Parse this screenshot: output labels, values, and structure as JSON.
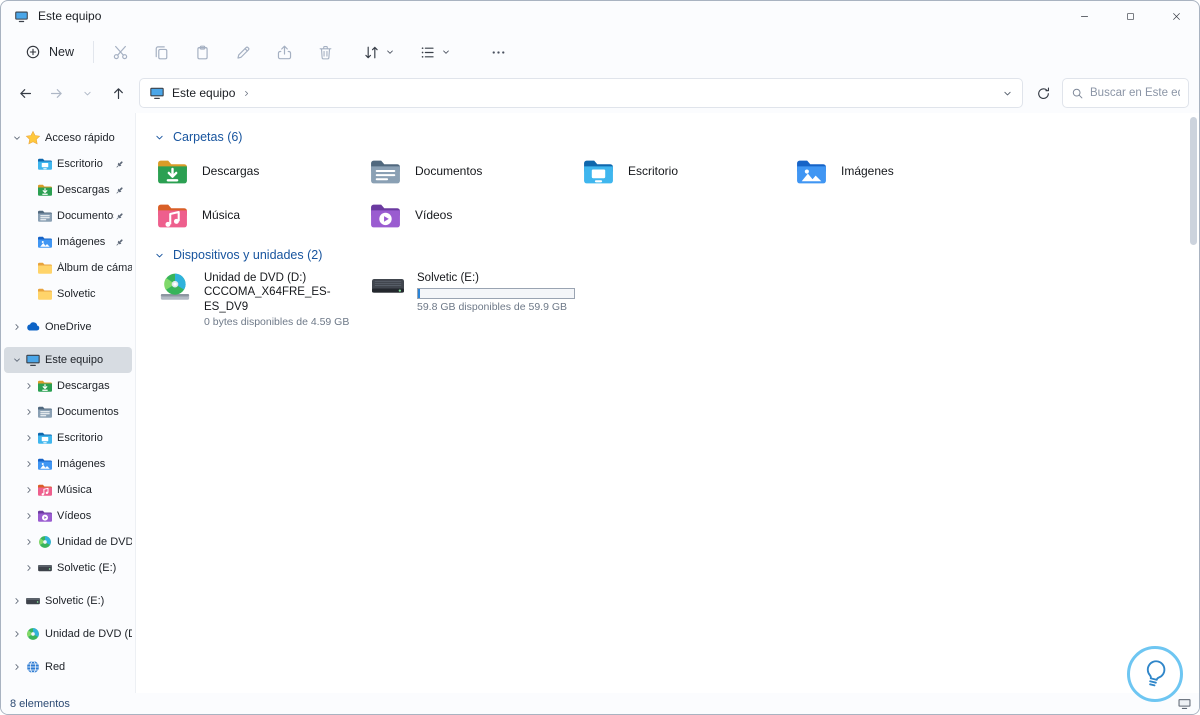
{
  "window": {
    "title": "Este equipo",
    "title_icon": "computer",
    "controls": [
      {
        "name": "minimize",
        "icon": "minimize"
      },
      {
        "name": "maximize",
        "icon": "maximize"
      },
      {
        "name": "close",
        "icon": "close"
      }
    ]
  },
  "toolbar": {
    "new_button": {
      "label": "New",
      "icon": "circle-plus"
    },
    "actions": [
      {
        "name": "cut",
        "icon": "cut",
        "enabled": false
      },
      {
        "name": "copy",
        "icon": "copy",
        "enabled": false
      },
      {
        "name": "paste",
        "icon": "paste",
        "enabled": false
      },
      {
        "name": "rename",
        "icon": "rename",
        "enabled": false
      },
      {
        "name": "share",
        "icon": "share",
        "enabled": false
      },
      {
        "name": "delete",
        "icon": "delete",
        "enabled": false
      }
    ],
    "sort_button": {
      "name": "sort",
      "icon": "sort"
    },
    "view_button": {
      "name": "view",
      "icon": "view"
    },
    "more_button": {
      "name": "more-options",
      "icon": "more"
    }
  },
  "navigation": [
    {
      "name": "back",
      "icon": "arrow-left",
      "enabled": true
    },
    {
      "name": "forward",
      "icon": "arrow-right",
      "enabled": false
    },
    {
      "name": "recent-locations",
      "icon": "chevron-down",
      "enabled": false
    },
    {
      "name": "up",
      "icon": "arrow-up",
      "enabled": true
    }
  ],
  "addressbar": {
    "root_icon": "computer",
    "path": "Este equipo",
    "separator_icon": "chevron-right",
    "dropdown_icon": "chevron-down",
    "refresh_icon": "refresh"
  },
  "search": {
    "icon": "search",
    "placeholder": "Buscar en Este eq..."
  },
  "sidebar": {
    "items": [
      {
        "label": "Acceso rápido",
        "icon": "quick-access",
        "level": 0,
        "chevron": "down"
      },
      {
        "label": "Escritorio",
        "icon": "desktop-folder",
        "level": 1,
        "pinned": true
      },
      {
        "label": "Descargas",
        "icon": "downloads-folder",
        "level": 1,
        "pinned": true
      },
      {
        "label": "Documentos",
        "icon": "documents-folder",
        "level": 1,
        "pinned": true
      },
      {
        "label": "Imágenes",
        "icon": "pictures-folder",
        "level": 1,
        "pinned": true
      },
      {
        "label": "Álbum de cámara",
        "icon": "folder",
        "level": 1
      },
      {
        "label": "Solvetic",
        "icon": "folder",
        "level": 1
      },
      {
        "spacer": true
      },
      {
        "label": "OneDrive",
        "icon": "onedrive",
        "level": 0,
        "chevron": "right"
      },
      {
        "spacer": true
      },
      {
        "label": "Este equipo",
        "icon": "computer",
        "level": 0,
        "chevron": "down",
        "selected": true
      },
      {
        "label": "Descargas",
        "icon": "downloads-folder",
        "level": 1,
        "chevron": "right"
      },
      {
        "label": "Documentos",
        "icon": "documents-folder",
        "level": 1,
        "chevron": "right"
      },
      {
        "label": "Escritorio",
        "icon": "desktop-folder",
        "level": 1,
        "chevron": "right"
      },
      {
        "label": "Imágenes",
        "icon": "pictures-folder",
        "level": 1,
        "chevron": "right"
      },
      {
        "label": "Música",
        "icon": "music-folder",
        "level": 1,
        "chevron": "right"
      },
      {
        "label": "Vídeos",
        "icon": "videos-folder",
        "level": 1,
        "chevron": "right"
      },
      {
        "label": "Unidad de DVD (D:",
        "icon": "dvd",
        "level": 1,
        "chevron": "right"
      },
      {
        "label": "Solvetic (E:)",
        "icon": "drive",
        "level": 1,
        "chevron": "right"
      },
      {
        "spacer": true
      },
      {
        "label": "Solvetic (E:)",
        "icon": "drive",
        "level": 0,
        "chevron": "right"
      },
      {
        "spacer": true
      },
      {
        "label": "Unidad de DVD (D:)",
        "icon": "dvd",
        "level": 0,
        "chevron": "right"
      },
      {
        "spacer": true
      },
      {
        "label": "Red",
        "icon": "network",
        "level": 0,
        "chevron": "right"
      }
    ]
  },
  "content": {
    "sections": [
      {
        "title": "Carpetas (6)",
        "type": "folders",
        "items": [
          {
            "label": "Descargas",
            "icon": "downloads-folder"
          },
          {
            "label": "Documentos",
            "icon": "documents-folder"
          },
          {
            "label": "Escritorio",
            "icon": "desktop-folder"
          },
          {
            "label": "Imágenes",
            "icon": "pictures-folder"
          },
          {
            "label": "Música",
            "icon": "music-folder"
          },
          {
            "label": "Vídeos",
            "icon": "videos-folder"
          }
        ]
      },
      {
        "title": "Dispositivos y unidades (2)",
        "type": "drives",
        "items": [
          {
            "label": "Unidad de DVD (D:)",
            "sublabel": "CCCOMA_X64FRE_ES-ES_DV9",
            "detail": "0 bytes disponibles de 4.59 GB",
            "icon": "dvd-drive"
          },
          {
            "label": "Solvetic (E:)",
            "detail": "59.8 GB disponibles de 59.9 GB",
            "icon": "hard-drive",
            "progress": 0.002
          }
        ]
      }
    ]
  },
  "statusbar": {
    "items_count": "8 elementos"
  },
  "watermark": {
    "bulb_icon": "lightbulb",
    "corner_icon": "monitor-small"
  },
  "colors": {
    "accent_blue": "#0067c0",
    "section_header_blue": "#17549e",
    "selected_nav_bg": "#d7dce2",
    "folder_yellow": "#ffd46a",
    "downloads_green": "#2ba052",
    "music_pink": "#ee5f8d",
    "videos_purple": "#9a5cd0",
    "pictures_blue": "#4096f3"
  }
}
